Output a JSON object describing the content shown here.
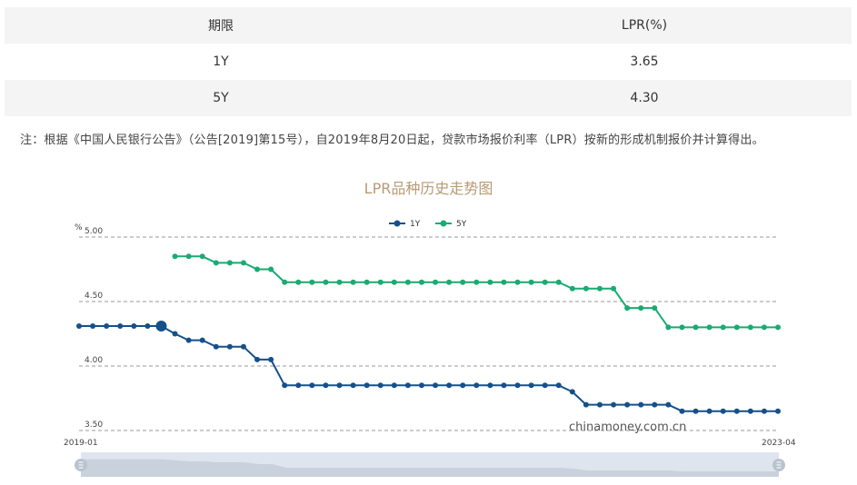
{
  "table": {
    "headers": [
      "期限",
      "LPR(%)"
    ],
    "rows": [
      {
        "term": "1Y",
        "rate": "3.65"
      },
      {
        "term": "5Y",
        "rate": "4.30"
      }
    ]
  },
  "note": "注：根据《中国人民银行公告》（公告[2019]第15号），自2019年8月20日起，贷款市场报价利率（LPR）按新的形成机制报价并计算得出。",
  "watermark": "chinamoney.com.cn",
  "colors": {
    "series_1y": "#15508a",
    "series_5y": "#1aaa72",
    "title": "#b89a74"
  },
  "chart_data": {
    "type": "line",
    "title": "LPR品种历史走势图",
    "ylabel": "%",
    "ylim": [
      3.5,
      5.0
    ],
    "yticks": [
      3.5,
      4.0,
      4.5,
      5.0
    ],
    "y_tick_labels": [
      "3.50",
      "4.00",
      "4.50",
      "5.00"
    ],
    "x_start_label": "2019-01",
    "x_end_label": "2023-04",
    "grid": true,
    "legend_position": "top-center",
    "series": [
      {
        "name": "1Y",
        "color": "#15508a",
        "values": [
          4.31,
          4.31,
          4.31,
          4.31,
          4.31,
          4.31,
          4.31,
          4.25,
          4.2,
          4.2,
          4.15,
          4.15,
          4.15,
          4.05,
          4.05,
          3.85,
          3.85,
          3.85,
          3.85,
          3.85,
          3.85,
          3.85,
          3.85,
          3.85,
          3.85,
          3.85,
          3.85,
          3.85,
          3.85,
          3.85,
          3.85,
          3.85,
          3.85,
          3.85,
          3.85,
          3.85,
          3.8,
          3.7,
          3.7,
          3.7,
          3.7,
          3.7,
          3.7,
          3.7,
          3.65,
          3.65,
          3.65,
          3.65,
          3.65,
          3.65,
          3.65,
          3.65
        ]
      },
      {
        "name": "5Y",
        "color": "#1aaa72",
        "values": [
          null,
          null,
          null,
          null,
          null,
          null,
          null,
          4.85,
          4.85,
          4.85,
          4.8,
          4.8,
          4.8,
          4.75,
          4.75,
          4.65,
          4.65,
          4.65,
          4.65,
          4.65,
          4.65,
          4.65,
          4.65,
          4.65,
          4.65,
          4.65,
          4.65,
          4.65,
          4.65,
          4.65,
          4.65,
          4.65,
          4.65,
          4.65,
          4.65,
          4.65,
          4.6,
          4.6,
          4.6,
          4.6,
          4.45,
          4.45,
          4.45,
          4.3,
          4.3,
          4.3,
          4.3,
          4.3,
          4.3,
          4.3,
          4.3,
          4.3
        ]
      }
    ],
    "highlight_index": 6
  }
}
